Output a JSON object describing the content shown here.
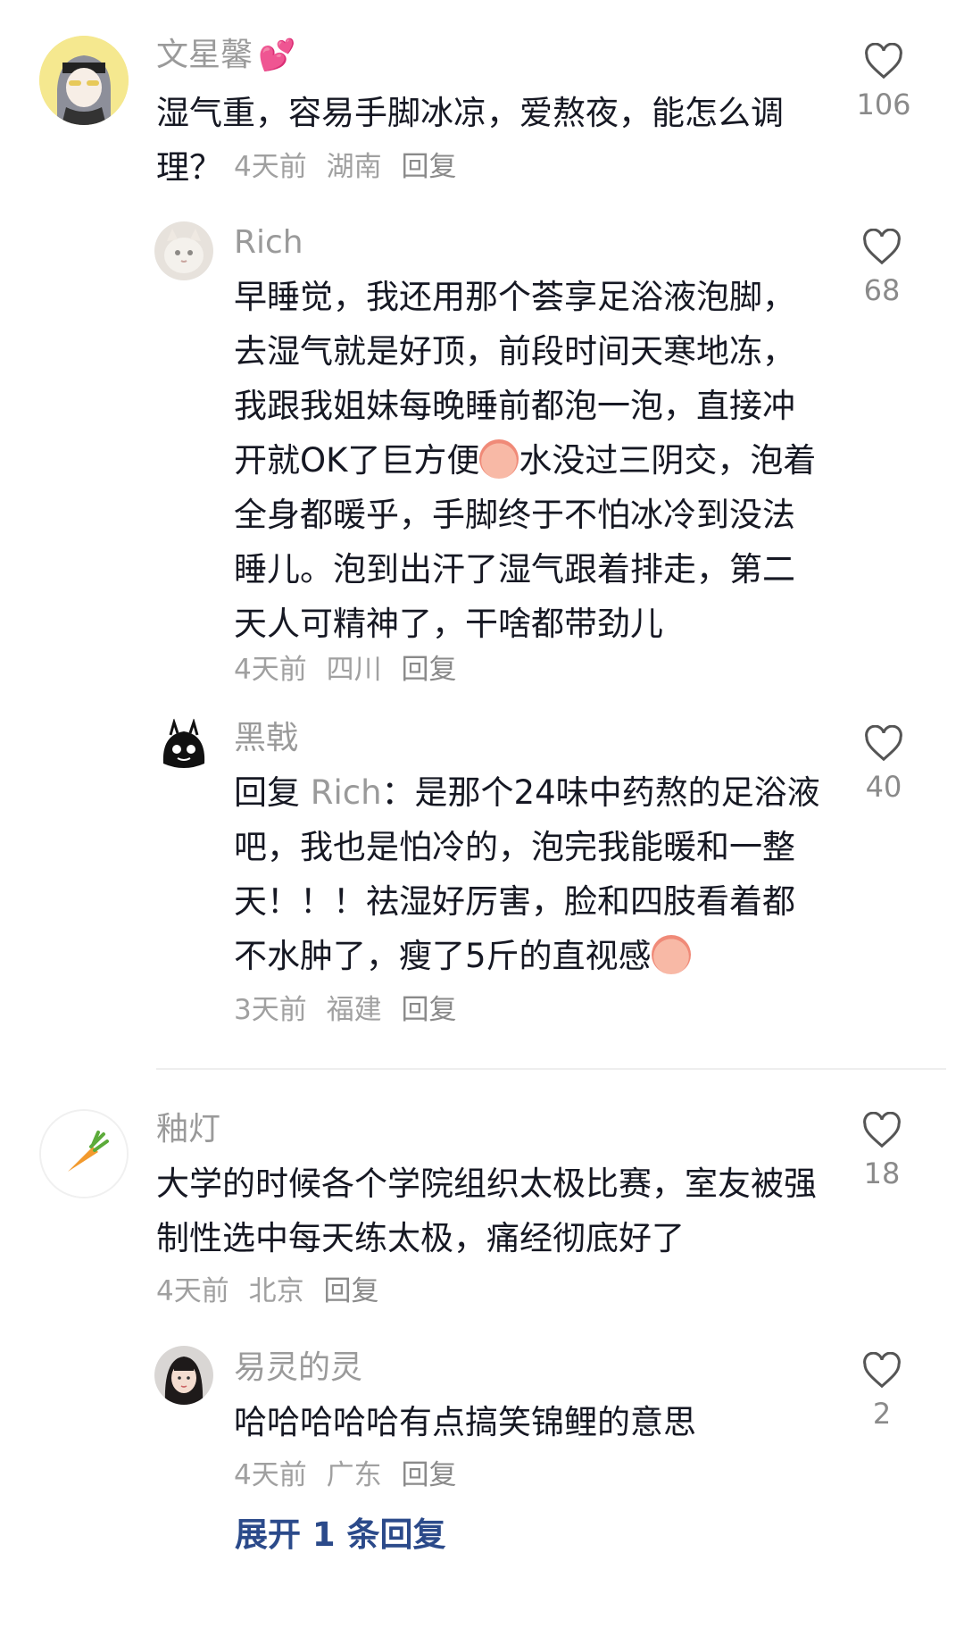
{
  "comments": [
    {
      "username": "文星馨",
      "username_emoji": "💕",
      "text": "湿气重，容易手脚冰凉，爱熬夜，能怎么调理？",
      "time": "4天前",
      "location": "湖南",
      "reply": "回复",
      "likes": "106",
      "replies": [
        {
          "username": "Rich",
          "text_a": "早睡觉，我还用那个荟享足浴液泡脚，去湿气就是好顶，前段时间天寒地冻，我跟我姐妹每晚睡前都泡一泡，直接冲开就OK了巨方便",
          "text_b": "水没过三阴交，泡着全身都暖乎，手脚终于不怕冰冷到没法睡儿。泡到出汗了湿气跟着排走，第二天人可精神了，干啥都带劲儿",
          "time": "4天前",
          "location": "四川",
          "reply": "回复",
          "likes": "68"
        },
        {
          "username": "黑戟",
          "reply_prefix": "回复",
          "reply_to": "Rich",
          "text": "：是那个24味中药熬的足浴液吧，我也是怕冷的，泡完我能暖和一整天！！！祛湿好厉害，脸和四肢看着都不水肿了，瘦了5斤的直视感",
          "time": "3天前",
          "location": "福建",
          "reply": "回复",
          "likes": "40"
        }
      ]
    },
    {
      "username": "釉灯",
      "text": "大学的时候各个学院组织太极比赛，室友被强制性选中每天练太极，痛经彻底好了",
      "time": "4天前",
      "location": "北京",
      "reply": "回复",
      "likes": "18",
      "replies": [
        {
          "username": "易灵的灵",
          "text": "哈哈哈哈哈有点搞笑锦鲤的意思",
          "time": "4天前",
          "location": "广东",
          "reply": "回复",
          "likes": "2"
        }
      ],
      "expand_label": "展开 1 条回复"
    }
  ],
  "colors": {
    "username": "#9a9a9a",
    "text": "#161823",
    "meta": "#a0a0a0",
    "expand": "#2b4a8a"
  },
  "icons": {
    "like": "heart-outline-icon",
    "carrot": "carrot-icon"
  }
}
